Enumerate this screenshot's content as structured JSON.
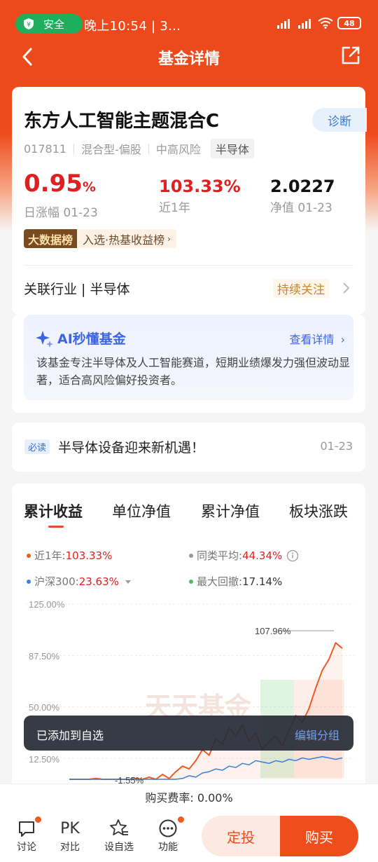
{
  "status_bar": {
    "safe_label": "安全",
    "time": "晚上10:54 | 3...",
    "battery": "48"
  },
  "nav": {
    "title": "基金详情"
  },
  "fund": {
    "name": "东方人工智能主题混合C",
    "diagnose_label": "诊断",
    "code": "017811",
    "type": "混合型-偏股",
    "risk": "中高风险",
    "sector_tag": "半导体",
    "daily_change": "0.95",
    "daily_change_unit": "%",
    "daily_change_label": "日涨幅 01-23",
    "one_year": "103.33%",
    "one_year_label": "近1年",
    "nav_value": "2.0227",
    "nav_label": "净值 01-23",
    "big_data_label": "大数据榜",
    "big_data_text": "入选·热基收益榜",
    "industry_label": "关联行业 | 半导体",
    "follow_label": "持续关注"
  },
  "ai": {
    "title": "AI秒懂基金",
    "link": "查看详情",
    "text": "该基金专注半导体及人工智能赛道，短期业绩爆发力强但波动显著，适合高风险偏好投资者。"
  },
  "news": {
    "tag": "必读",
    "title": "半导体设备迎来新机遇！",
    "date": "01-23"
  },
  "chart_tabs": [
    "累计收益",
    "单位净值",
    "累计净值",
    "板块涨跌"
  ],
  "legend": {
    "fund_label": "近1年:",
    "fund_value": "103.33%",
    "avg_label": "同类平均:",
    "avg_value": "44.34%",
    "hs300_label": "沪深300:",
    "hs300_value": "23.63%",
    "drawdown_label": "最大回撤:",
    "drawdown_value": "17.14%"
  },
  "colors": {
    "fund": "#ee5a24",
    "average": "#999999",
    "hs300": "#3a7fd8",
    "drawdown": "#4cc05a"
  },
  "chart_data": {
    "type": "line",
    "ylim": [
      0,
      125
    ],
    "yticks": [
      "125.00%",
      "87.50%",
      "50.00%",
      "12.50%"
    ],
    "annotations": [
      "107.96%",
      "-1.55%"
    ],
    "series": [
      {
        "name": "近1年",
        "values": [
          -2,
          2,
          6,
          4,
          9,
          5,
          8,
          4,
          7,
          5,
          9,
          6,
          10,
          8,
          12,
          9,
          14,
          18,
          16,
          22,
          30,
          26,
          38,
          34,
          46,
          40,
          48,
          36,
          42,
          30,
          36,
          40,
          33,
          44,
          55,
          50,
          60,
          75,
          88,
          96,
          108,
          104
        ]
      },
      {
        "name": "沪深300",
        "values": [
          0,
          -1,
          2,
          1,
          3,
          2,
          4,
          2,
          3,
          1,
          4,
          3,
          5,
          4,
          6,
          5,
          8,
          9,
          11,
          10,
          13,
          14,
          16,
          15,
          18,
          17,
          20,
          19,
          22,
          21,
          20,
          22,
          21,
          23,
          22,
          24,
          23,
          24,
          25,
          24,
          23,
          24
        ]
      }
    ]
  },
  "toast": {
    "message": "已添加到自选",
    "action": "编辑分组"
  },
  "fee": {
    "text": "购买费率: 0.00%"
  },
  "bottom_bar": {
    "discuss": "讨论",
    "pk": "PK",
    "compare": "对比",
    "watchlist": "设自选",
    "functions": "功能",
    "invest_plan": "定投",
    "buy": "购买"
  }
}
